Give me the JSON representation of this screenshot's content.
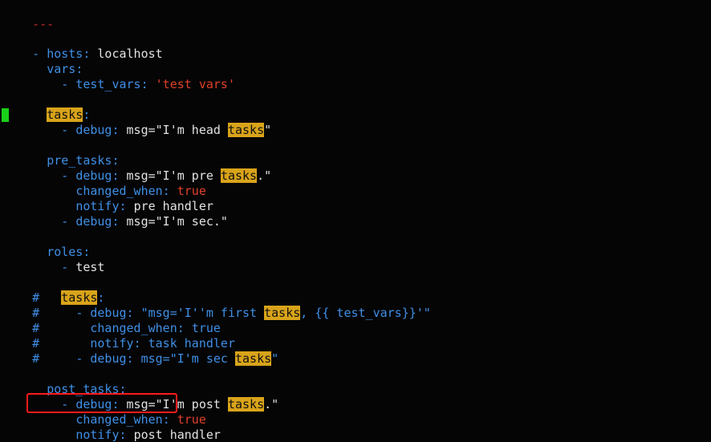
{
  "doc_start": "---",
  "hosts_line": {
    "dash": "- ",
    "key": "hosts",
    "colon": ": ",
    "value": "localhost"
  },
  "vars_key": "vars",
  "test_vars_line": {
    "dash": "- ",
    "key": "test_vars",
    "colon": ": ",
    "value": "'test vars'"
  },
  "tasks_key": "tasks",
  "head_debug": {
    "dash": "- ",
    "key": "debug",
    "colon": ": ",
    "pre": "msg=\"I'm head ",
    "hl": "tasks",
    "post": "\""
  },
  "pre_tasks_key": "pre_tasks",
  "pre_debug": {
    "dash": "- ",
    "key": "debug",
    "colon": ": ",
    "pre": "msg=\"I'm pre ",
    "hl": "tasks",
    "post": ".\""
  },
  "pre_changed": {
    "key": "changed_when",
    "colon": ": ",
    "value": "true"
  },
  "pre_notify": {
    "key": "notify",
    "colon": ": ",
    "value": "pre handler"
  },
  "pre_debug2": {
    "dash": "- ",
    "key": "debug",
    "colon": ": ",
    "value": "msg=\"I'm sec.\""
  },
  "roles_key": "roles",
  "roles_item": {
    "dash": "- ",
    "value": "test"
  },
  "comment_tasks": {
    "hash": "#",
    "hl": "tasks",
    "colon": ":"
  },
  "comment_debug": {
    "hash": "#",
    "dash": "- ",
    "key": "debug",
    "colon": ": ",
    "pre": "\"msg='I''m first ",
    "hl": "tasks",
    "post": ", {{ test_vars}}'\""
  },
  "comment_changed": {
    "hash": "#",
    "key": "changed_when",
    "colon": ": ",
    "value": "true"
  },
  "comment_notify": {
    "hash": "#",
    "key": "notify",
    "colon": ": ",
    "value": "task handler"
  },
  "comment_debug2": {
    "hash": "#",
    "dash": "- ",
    "key": "debug",
    "colon": ": ",
    "pre": "msg=\"I'm sec ",
    "hl": "tasks",
    "post": "\""
  },
  "post_tasks_key": "post_tasks",
  "post_debug": {
    "dash": "- ",
    "key": "debug",
    "colon": ": ",
    "pre": "msg=\"I'm post ",
    "hl": "tasks",
    "post": ".\""
  },
  "post_changed": {
    "key": "changed_when",
    "colon": ": ",
    "value": "true"
  },
  "post_notify": {
    "key": "notify",
    "colon": ": ",
    "value": "post handler"
  },
  "colors": {
    "background": "#050505",
    "key": "#3f8fe6",
    "string": "#e0402a",
    "search_highlight": "#d9a41a",
    "cursor": "#18d018",
    "annotation": "#ff1a1a"
  }
}
